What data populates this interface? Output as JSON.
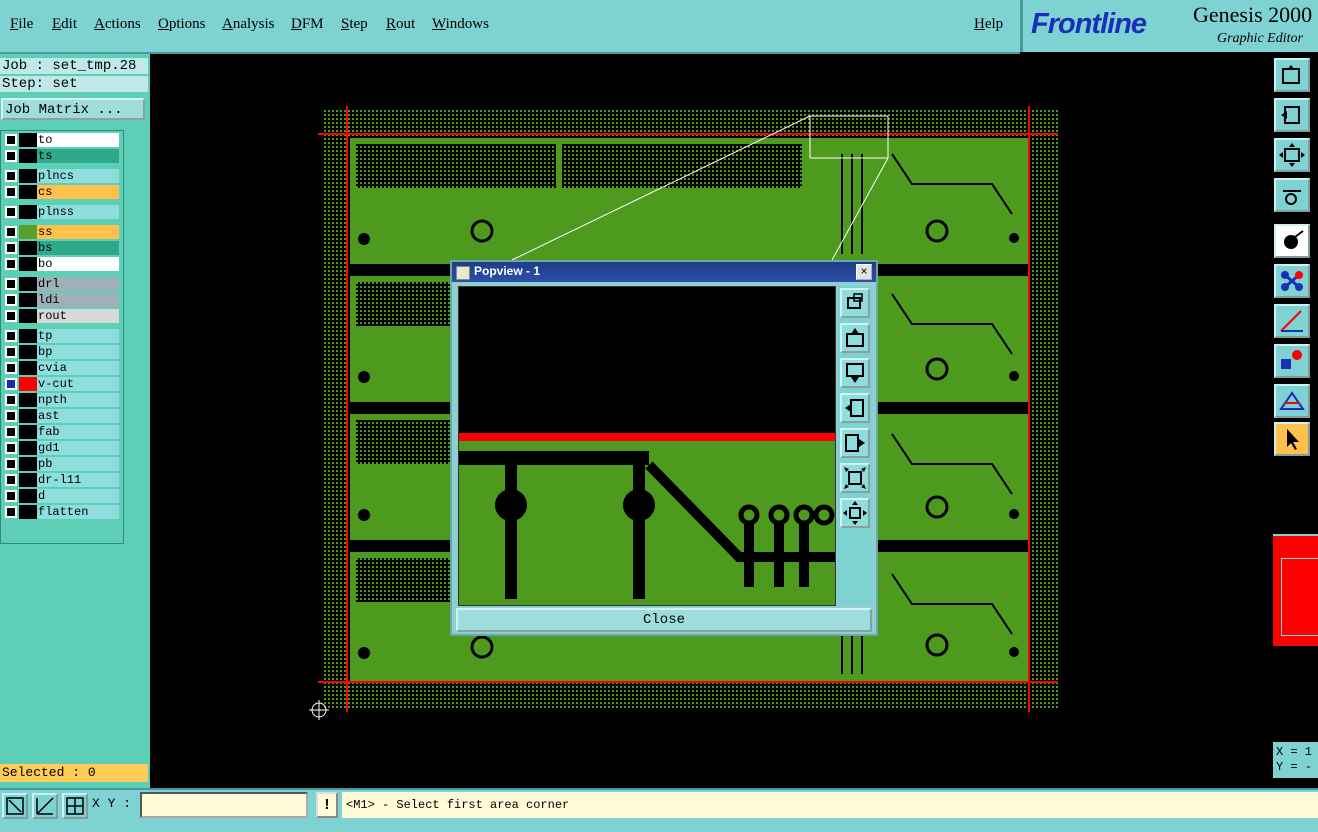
{
  "menu": {
    "items": [
      "File",
      "Edit",
      "Actions",
      "Options",
      "Analysis",
      "DFM",
      "Step",
      "Rout",
      "Windows"
    ],
    "help": "Help"
  },
  "brand": {
    "logo": "Frontline",
    "product": "Genesis 2000",
    "subtitle": "Graphic Editor"
  },
  "job": {
    "job_line": "Job : set_tmp.28",
    "step_line": "Step: set",
    "matrix_button": "Job Matrix ..."
  },
  "layers": [
    {
      "name": "to",
      "color": "#ffffff",
      "box": "#000000"
    },
    {
      "name": "ts",
      "color": "#2fa88c",
      "box": "#000000"
    },
    {
      "name": "plncs",
      "color": "#8fdede",
      "box": "#000000"
    },
    {
      "name": "cs",
      "color": "#ffc04c",
      "box": "#000000"
    },
    {
      "name": "plnss",
      "color": "#8fdede",
      "box": "#000000"
    },
    {
      "name": "ss",
      "color": "#ffc04c",
      "box": "#5aa02c"
    },
    {
      "name": "bs",
      "color": "#2fa88c",
      "box": "#000000"
    },
    {
      "name": "bo",
      "color": "#ffffff",
      "box": "#000000"
    },
    {
      "name": "drl",
      "color": "#9fb0b8",
      "box": "#000000"
    },
    {
      "name": "ldi",
      "color": "#9fb0b8",
      "box": "#000000"
    },
    {
      "name": "rout",
      "color": "#d8d8d8",
      "box": "#000000"
    },
    {
      "name": "tp",
      "color": "#8fdede",
      "box": "#000000"
    },
    {
      "name": "bp",
      "color": "#8fdede",
      "box": "#000000"
    },
    {
      "name": "cvia",
      "color": "#8fdede",
      "box": "#000000"
    },
    {
      "name": "v-cut",
      "color": "#8fdede",
      "box": "#ff0000",
      "active": true
    },
    {
      "name": "npth",
      "color": "#8fdede",
      "box": "#000000"
    },
    {
      "name": "ast",
      "color": "#8fdede",
      "box": "#000000"
    },
    {
      "name": "fab",
      "color": "#8fdede",
      "box": "#000000"
    },
    {
      "name": "gd1",
      "color": "#8fdede",
      "box": "#000000"
    },
    {
      "name": "pb",
      "color": "#8fdede",
      "box": "#000000"
    },
    {
      "name": "dr-l11",
      "color": "#8fdede",
      "box": "#000000"
    },
    {
      "name": "d",
      "color": "#8fdede",
      "box": "#000000"
    },
    {
      "name": "flatten",
      "color": "#8fdede",
      "box": "#000000"
    }
  ],
  "status": {
    "selected": "Selected : 0",
    "xy_label": "X Y :",
    "xy_value": "",
    "exclamation": "!",
    "prompt": "<M1> - Select first area corner",
    "coord_x": "X = 1",
    "coord_y": "Y = -"
  },
  "popview": {
    "title": "Popview - 1",
    "close_label": "Close",
    "close_x": "×"
  },
  "colors": {
    "panel": "#7fd2d2",
    "board_green": "#4d9a1e",
    "vcut_red": "#ff0000",
    "selected_bar": "#ffcc55",
    "prompt_bg": "#fffbd6"
  },
  "icons": {
    "right_toolbar": [
      "pan-icon",
      "zoom-in-icon",
      "zoom-fit-icon",
      "measure-icon",
      "snap-icon",
      "network-icon",
      "angle-icon",
      "select-element-icon",
      "triangle-icon",
      "pointer-icon"
    ],
    "bottom_bar": [
      "zoom-area-icon",
      "zoom-measure-icon",
      "grid-icon"
    ],
    "popview_tools": [
      "pv-zoom-icon",
      "pv-pan-up-icon",
      "pv-pan-down-icon",
      "pv-pan-left-icon",
      "pv-pan-right-icon",
      "pv-fit-icon",
      "pv-center-icon"
    ]
  }
}
